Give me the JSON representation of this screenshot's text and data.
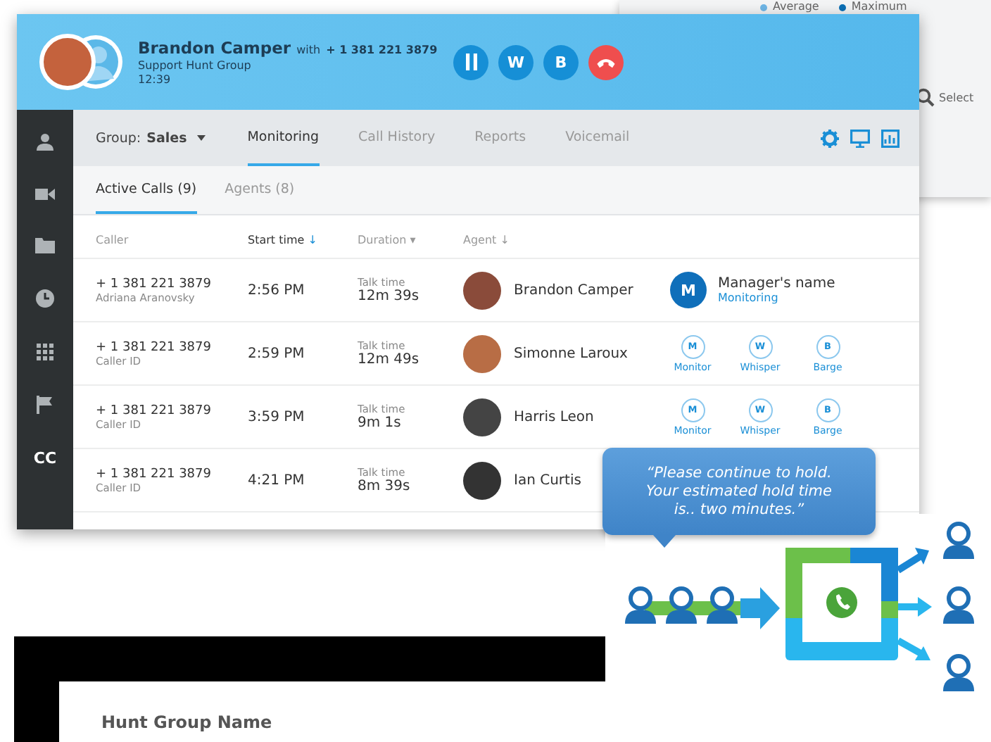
{
  "background_window": {
    "legend": [
      {
        "label": "Average",
        "color": "#6fb6e6"
      },
      {
        "label": "Maximum",
        "color": "#0b6fb5"
      }
    ],
    "search_label": "Select"
  },
  "call_bar": {
    "agent": "Brandon Camper",
    "with_label": "with",
    "number": "+ 1 381 221 3879",
    "group": "Support Hunt Group",
    "time": "12:39",
    "buttons": [
      {
        "kind": "hold"
      },
      {
        "kind": "letter",
        "label": "W"
      },
      {
        "kind": "letter",
        "label": "B"
      },
      {
        "kind": "hangup"
      }
    ]
  },
  "sidebar": {
    "label": "CC"
  },
  "nav": {
    "group_label": "Group:",
    "group_value": "Sales",
    "tabs": [
      {
        "label": "Monitoring",
        "selected": true
      },
      {
        "label": "Call History",
        "selected": false
      },
      {
        "label": "Reports",
        "selected": false
      },
      {
        "label": "Voicemail",
        "selected": false
      }
    ]
  },
  "subtabs": [
    {
      "label": "Active Calls (9)",
      "selected": true
    },
    {
      "label": "Agents (8)",
      "selected": false
    }
  ],
  "table": {
    "columns": [
      {
        "label": "Caller",
        "active": false
      },
      {
        "label": "Start time",
        "indicator": "↓",
        "active": true
      },
      {
        "label": "Duration",
        "indicator": "▾",
        "active": false
      },
      {
        "label": "Agent",
        "indicator": "↓",
        "active": false
      }
    ],
    "rows": [
      {
        "number": "+ 1 381 221 3879",
        "caller": "Adriana Aranovsky",
        "start": "2:56 PM",
        "duration_label": "Talk time",
        "duration": "12m 39s",
        "agent": "Brandon Camper",
        "action": {
          "kind": "monitoring",
          "initial": "M",
          "manager": "Manager's name",
          "status": "Monitoring"
        }
      },
      {
        "number": "+ 1 381 221 3879",
        "caller": "Caller ID",
        "start": "2:59 PM",
        "duration_label": "Talk time",
        "duration": "12m 49s",
        "agent": "Simonne Laroux",
        "action": {
          "kind": "controls",
          "buttons": [
            {
              "letter": "M",
              "label": "Monitor"
            },
            {
              "letter": "W",
              "label": "Whisper"
            },
            {
              "letter": "B",
              "label": "Barge"
            }
          ]
        }
      },
      {
        "number": "+ 1 381 221 3879",
        "caller": "Caller ID",
        "start": "3:59 PM",
        "duration_label": "Talk time",
        "duration": "9m 1s",
        "agent": "Harris Leon",
        "action": {
          "kind": "controls",
          "buttons": [
            {
              "letter": "M",
              "label": "Monitor"
            },
            {
              "letter": "W",
              "label": "Whisper"
            },
            {
              "letter": "B",
              "label": "Barge"
            }
          ]
        }
      },
      {
        "number": "+ 1 381 221 3879",
        "caller": "Caller ID",
        "start": "4:21 PM",
        "duration_label": "Talk time",
        "duration": "8m 39s",
        "agent": "Ian Curtis",
        "action": {
          "kind": "none"
        }
      }
    ]
  },
  "hold_message": "“Please continue to hold. Your estimated hold time is.. two minutes.”",
  "bottom_window": {
    "title": "Hunt Group Name"
  }
}
